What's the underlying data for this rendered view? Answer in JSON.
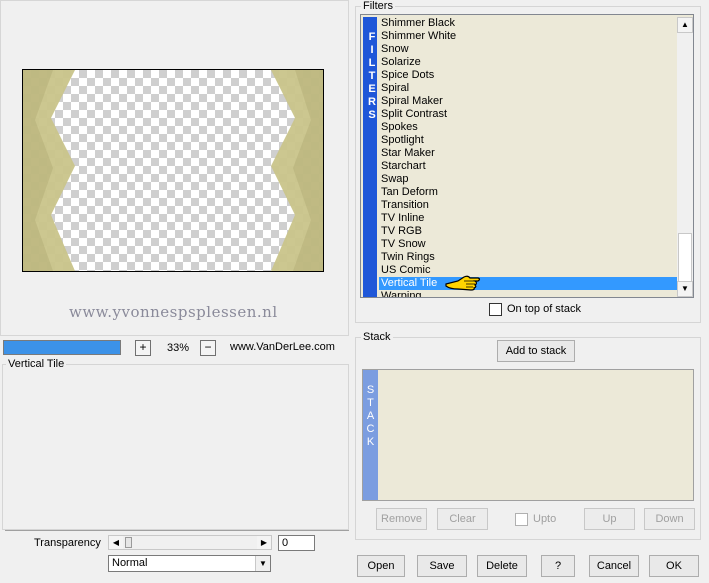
{
  "preview": {
    "watermark": "www.yvonnespsplessen.nl",
    "progress_percent": 100,
    "zoom_in_label": "+",
    "zoom_value": "33%",
    "zoom_out_label": "−",
    "website": "www.VanDerLee.com"
  },
  "filters": {
    "group_label": "Filters",
    "stripe_text": "FILTERS",
    "items": [
      "Shimmer Black",
      "Shimmer White",
      "Snow",
      "Solarize",
      "Spice Dots",
      "Spiral",
      "Spiral Maker",
      "Split Contrast",
      "Spokes",
      "Spotlight",
      "Star Maker",
      "Starchart",
      "Swap",
      "Tan Deform",
      "Transition",
      "TV Inline",
      "TV RGB",
      "TV Snow",
      "Twin Rings",
      "US Comic",
      "Vertical Tile",
      "Warping"
    ],
    "selected": "Vertical Tile",
    "on_top_label": "On top of stack"
  },
  "settings": {
    "group_label": "Vertical Tile",
    "transparency_label": "Transparency",
    "transparency_value": "0",
    "blend_mode": "Normal"
  },
  "stack": {
    "group_label": "Stack",
    "add_label": "Add to stack",
    "stripe_text": "STACK",
    "remove_label": "Remove",
    "clear_label": "Clear",
    "upto_label": "Upto",
    "up_label": "Up",
    "down_label": "Down"
  },
  "footer": {
    "open_label": "Open",
    "save_label": "Save",
    "delete_label": "Delete",
    "help_label": "?",
    "cancel_label": "Cancel",
    "ok_label": "OK"
  },
  "colors": {
    "accent": "#3399ff",
    "filter_stripe": "#1f57d8",
    "stack_stripe": "#7b9de0",
    "tile_khaki": "#c9c48a",
    "list_bg": "#ece9d8"
  }
}
